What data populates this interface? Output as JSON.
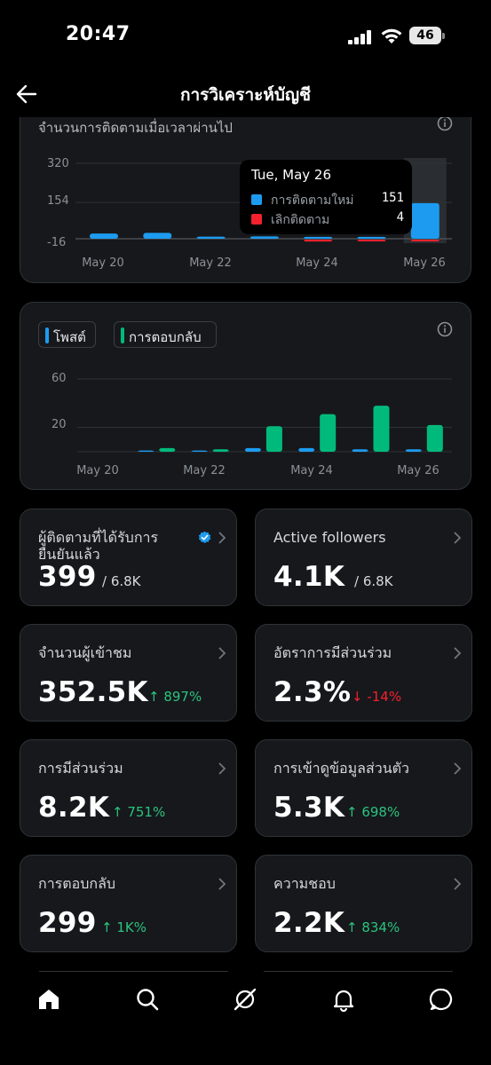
{
  "status_bar": {
    "time": "20:47",
    "battery": "46"
  },
  "header": {
    "title": "การวิเคราะห์บัญชี"
  },
  "followers_chart": {
    "title": "จำนวนการติดตามเมื่อเวลาผ่านไป",
    "y_ticks": [
      "320",
      "154",
      "-16"
    ],
    "x_ticks": [
      "May 20",
      "May 22",
      "May 24",
      "May 26"
    ],
    "tooltip": {
      "date": "Tue, May 26",
      "rows": [
        {
          "label": "การติดตามใหม่",
          "value": "151",
          "color": "#1d9bf0"
        },
        {
          "label": "เลิกติดตาม",
          "value": "4",
          "color": "#f4212e"
        }
      ]
    }
  },
  "posts_chart": {
    "legend": [
      {
        "label": "โพสต์",
        "color": "#1d9bf0"
      },
      {
        "label": "การตอบกลับ",
        "color": "#00ba7c"
      }
    ],
    "y_ticks": [
      "60",
      "20"
    ],
    "x_ticks": [
      "May 20",
      "May 22",
      "May 24",
      "May 26"
    ]
  },
  "chart_data": [
    {
      "type": "bar",
      "title": "จำนวนการติดตามเมื่อเวลาผ่านไป",
      "categories": [
        "May 20",
        "May 21",
        "May 22",
        "May 23",
        "May 24",
        "May 25",
        "May 26"
      ],
      "series": [
        {
          "name": "การติดตามใหม่",
          "values": [
            22,
            25,
            9,
            10,
            8,
            8,
            151
          ],
          "color": "#1d9bf0"
        },
        {
          "name": "เลิกติดตาม",
          "values": [
            0,
            0,
            0,
            0,
            -8,
            -6,
            -4
          ],
          "color": "#f4212e"
        }
      ],
      "ylim": [
        -16,
        320
      ],
      "y_ticks": [
        320,
        154,
        -16
      ],
      "highlight": "May 26"
    },
    {
      "type": "bar",
      "categories": [
        "May 20",
        "May 21",
        "May 22",
        "May 23",
        "May 24",
        "May 25",
        "May 26"
      ],
      "series": [
        {
          "name": "โพสต์",
          "values": [
            0,
            1,
            1,
            3,
            3,
            2,
            2
          ],
          "color": "#1d9bf0"
        },
        {
          "name": "การตอบกลับ",
          "values": [
            0,
            3,
            2,
            21,
            31,
            38,
            22
          ],
          "color": "#00ba7c"
        }
      ],
      "ylim": [
        0,
        60
      ],
      "y_ticks": [
        60,
        20
      ]
    }
  ],
  "stats": [
    {
      "label": "ผู้ติดตามที่ได้รับการยืนยันแล้ว",
      "value": "399",
      "suffix": "/ 6.8K",
      "verified": true
    },
    {
      "label": "Active followers",
      "value": "4.1K",
      "suffix": "/ 6.8K"
    },
    {
      "label": "จำนวนผู้เข้าชม",
      "value": "352.5K",
      "delta": "↑ 897%",
      "trend": "up"
    },
    {
      "label": "อัตราการมีส่วนร่วม",
      "value": "2.3%",
      "delta": "↓ -14%",
      "trend": "down"
    },
    {
      "label": "การมีส่วนร่วม",
      "value": "8.2K",
      "delta": "↑ 751%",
      "trend": "up"
    },
    {
      "label": "การเข้าดูข้อมูลส่วนตัว",
      "value": "5.3K",
      "delta": "↑ 698%",
      "trend": "up"
    },
    {
      "label": "การตอบกลับ",
      "value": "299",
      "delta": "↑ 1K%",
      "trend": "up"
    },
    {
      "label": "ความชอบ",
      "value": "2.2K",
      "delta": "↑ 834%",
      "trend": "up"
    }
  ],
  "nav": {
    "icons": [
      "home-icon",
      "search-icon",
      "grok-icon",
      "notifications-icon",
      "messages-icon"
    ]
  }
}
